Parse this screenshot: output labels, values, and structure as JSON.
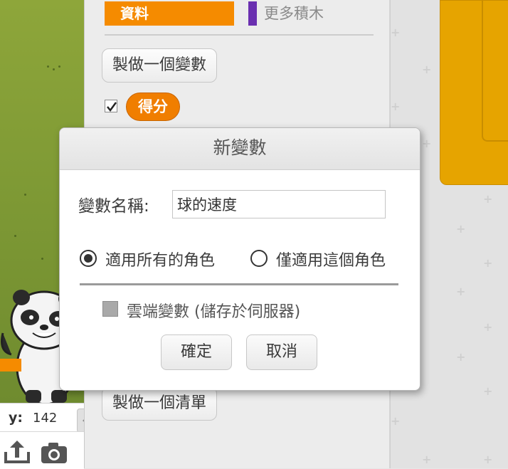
{
  "stage": {
    "y_label": "y:",
    "y_value": "142"
  },
  "palette": {
    "category_active": "資料",
    "category_other": "更多積木",
    "make_variable_button": "製做一個變數",
    "variable_name": "得分",
    "make_list_button": "製做一個清單"
  },
  "dialog": {
    "title": "新變數",
    "name_label": "變數名稱:",
    "name_value": "球的速度",
    "scope_all": "適用所有的角色",
    "scope_this": "僅適用這個角色",
    "cloud_label": "雲端變數 (儲存於伺服器)",
    "ok_button": "確定",
    "cancel_button": "取消"
  },
  "colors": {
    "data_category": "#f58b00",
    "more_blocks_category": "#6a2fb0",
    "script_block": "#e6a400"
  },
  "icons": {
    "upload": "upload-sprite-icon",
    "camera": "camera-icon",
    "collapse": "chevron-left-icon"
  }
}
